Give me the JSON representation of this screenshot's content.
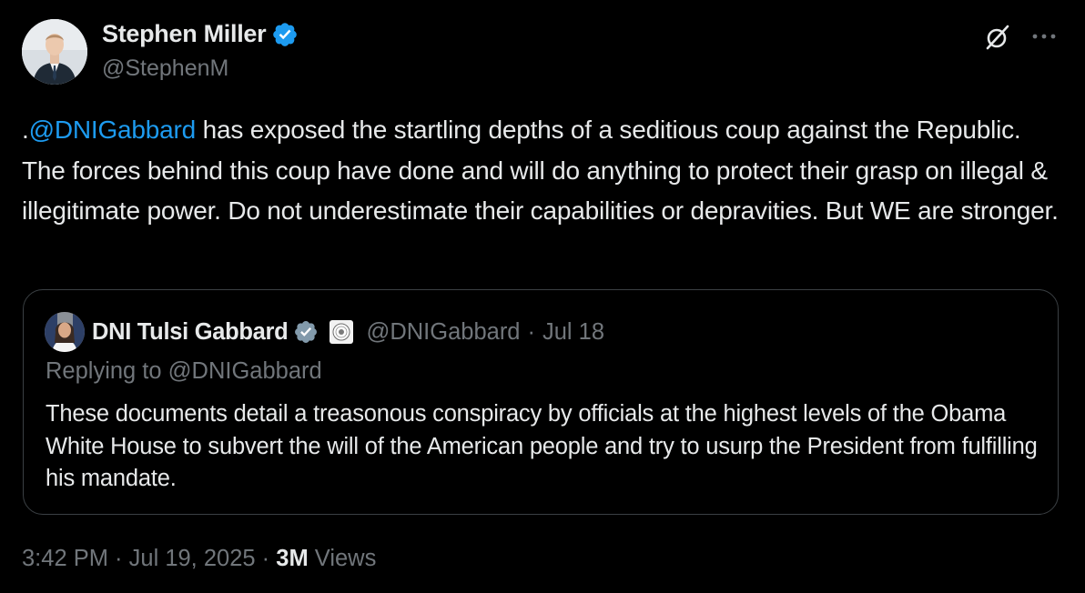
{
  "author": {
    "display_name": "Stephen Miller",
    "handle": "@StephenM",
    "verified": true,
    "avatar_icon": "person-avatar"
  },
  "header_actions": {
    "grok_icon": "grok-icon",
    "more_icon": "more-horizontal-icon"
  },
  "post": {
    "prefix": ".",
    "mention": "@DNIGabbard",
    "text_rest": " has exposed the startling depths of a seditious coup against the Republic. The forces behind this coup have done and will do anything to protect their grasp on illegal & illegitimate power. Do not underestimate their capabilities or depravities. But WE are stronger."
  },
  "quoted": {
    "display_name": "DNI Tulsi Gabbard",
    "verified": true,
    "affiliation_icon": "odni-seal-badge",
    "handle": "@DNIGabbard",
    "separator": "·",
    "date": "Jul 18",
    "replying_to": "Replying to @DNIGabbard",
    "text": "These documents detail a treasonous conspiracy by officials at the highest levels of the Obama White House to subvert the will of the American people and try to usurp the President from fulfilling his mandate."
  },
  "meta": {
    "time": "3:42 PM",
    "separator": " · ",
    "date": "Jul 19, 2025",
    "views_count": "3M",
    "views_label": " Views"
  },
  "colors": {
    "background": "#000000",
    "text_primary": "#e7e9ea",
    "text_secondary": "#71767b",
    "link": "#1d9bf0",
    "border": "#3b4044",
    "verified_blue": "#1d9bf0",
    "verified_gray": "#829aab"
  }
}
